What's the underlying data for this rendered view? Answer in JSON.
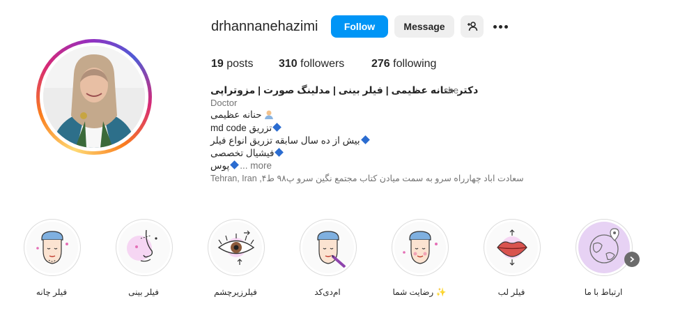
{
  "profile": {
    "username": "drhannanehazimi",
    "follow_label": "Follow",
    "message_label": "Message",
    "posts_count": "19",
    "posts_label": "posts",
    "followers_count": "310",
    "followers_label": "followers",
    "following_count": "276",
    "following_label": "following",
    "display_name": "دکتر حنانه عظیمی | فیلر بینی | مدلینگ صورت | مزوتراپی",
    "pronouns": "she",
    "category": "Doctor",
    "bio_lines": [
      "حنانه عظیمی",
      "تزریق md code",
      "بیش از ده سال سابقه تزریق انواع فیلر",
      "فیشیال تخصصی",
      "پوس"
    ],
    "more_label": "... more",
    "location": "سعادت اباد چهارراه سرو به سمت میادن کتاب مجتمع نگین سرو پ۹۸ ط۴, Tehran, Iran"
  },
  "highlights": [
    {
      "label": "ارتباط با ما",
      "icon": "globe-icon"
    },
    {
      "label": "فیلر لب",
      "icon": "lips-icon"
    },
    {
      "label": "رضایت شما ✨",
      "icon": "face-icon"
    },
    {
      "label": "ام‌دی‌کد",
      "icon": "face-injection-icon"
    },
    {
      "label": "فیلرزیرچشم",
      "icon": "eye-icon"
    },
    {
      "label": "فیلر بینی",
      "icon": "nose-icon"
    },
    {
      "label": "فیلر چانه",
      "icon": "face-chin-icon"
    }
  ],
  "colors": {
    "follow_button": "#0095f6",
    "secondary_button": "#efefef",
    "muted_text": "#737373",
    "highlight_accent": "#f6d6f3"
  }
}
